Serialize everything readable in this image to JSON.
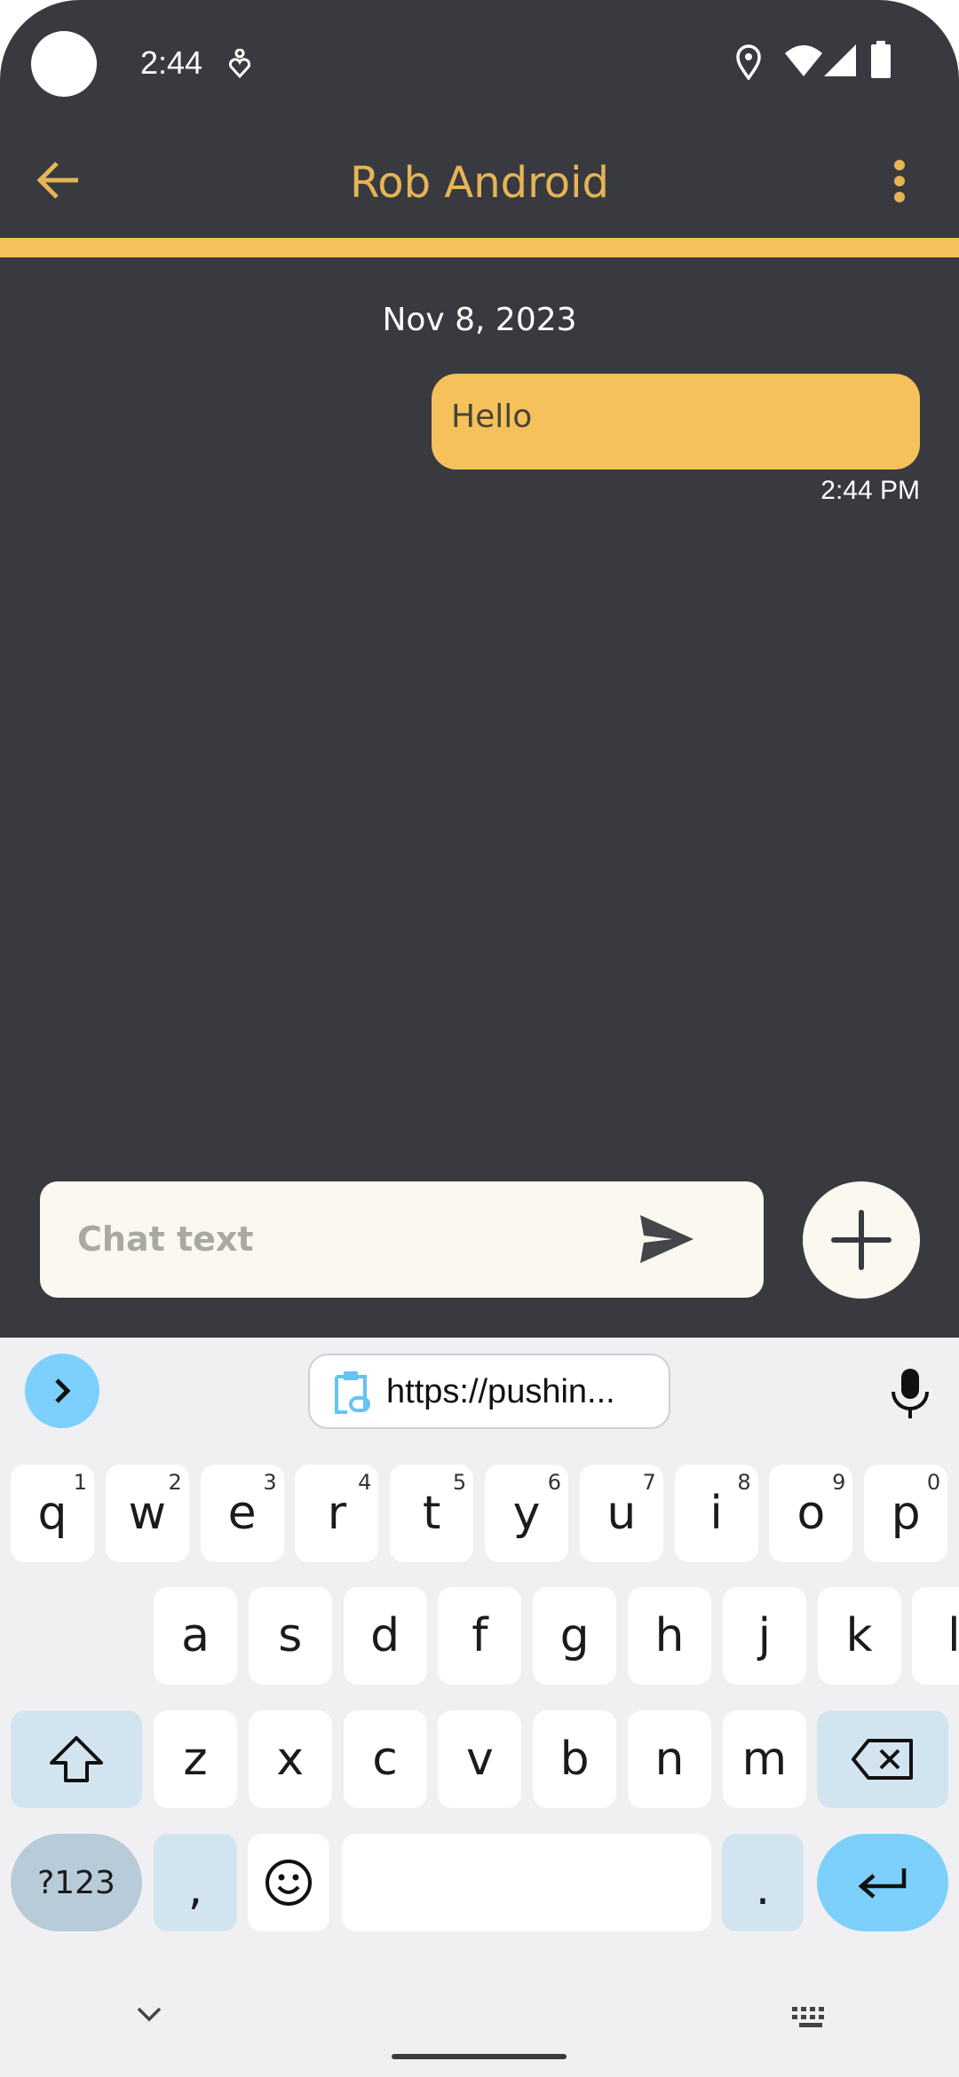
{
  "status_bar": {
    "time": "2:44",
    "icons": [
      "accessibility-icon",
      "location-icon",
      "wifi-icon",
      "signal-icon",
      "battery-icon"
    ]
  },
  "toolbar": {
    "title": "Rob Android",
    "back_icon": "arrow-back-icon",
    "menu_icon": "more-vert-icon"
  },
  "colors": {
    "accent": "#f5c15a",
    "background": "#383a3f",
    "title": "#e6b456",
    "input_bg": "#fbf8ef",
    "keyboard_accent": "#7cd0fb"
  },
  "chat": {
    "date": "Nov 8, 2023",
    "messages": [
      {
        "text": "Hello",
        "time": "2:44 PM",
        "outgoing": true
      }
    ]
  },
  "composer": {
    "placeholder": "Chat text",
    "value": "",
    "send_icon": "send-icon",
    "add_icon": "plus-icon"
  },
  "keyboard": {
    "clipboard_suggestion": "https://pushin...",
    "rows": [
      [
        {
          "k": "q",
          "s": "1"
        },
        {
          "k": "w",
          "s": "2"
        },
        {
          "k": "e",
          "s": "3"
        },
        {
          "k": "r",
          "s": "4"
        },
        {
          "k": "t",
          "s": "5"
        },
        {
          "k": "y",
          "s": "6"
        },
        {
          "k": "u",
          "s": "7"
        },
        {
          "k": "i",
          "s": "8"
        },
        {
          "k": "o",
          "s": "9"
        },
        {
          "k": "p",
          "s": "0"
        }
      ],
      [
        {
          "k": "a"
        },
        {
          "k": "s"
        },
        {
          "k": "d"
        },
        {
          "k": "f"
        },
        {
          "k": "g"
        },
        {
          "k": "h"
        },
        {
          "k": "j"
        },
        {
          "k": "k"
        },
        {
          "k": "l"
        }
      ],
      [
        {
          "k": "z"
        },
        {
          "k": "x"
        },
        {
          "k": "c"
        },
        {
          "k": "v"
        },
        {
          "k": "b"
        },
        {
          "k": "n"
        },
        {
          "k": "m"
        }
      ]
    ],
    "symbols_label": "?123",
    "comma": ",",
    "period": "."
  }
}
